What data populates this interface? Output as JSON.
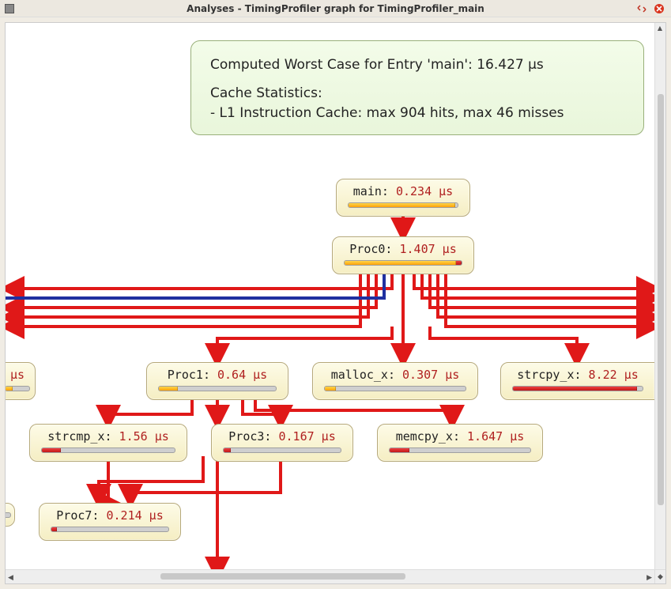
{
  "window": {
    "title": "Analyses - TimingProfiler graph for TimingProfiler_main"
  },
  "stats": {
    "line1": "Computed Worst Case for Entry 'main': 16.427 µs",
    "line2": "Cache Statistics:",
    "line3": " - L1 Instruction Cache: max 904 hits, max 46 misses"
  },
  "nodes": {
    "main": {
      "name": "main",
      "time": "0.234 µs",
      "fill_pct": 98,
      "fill_color": "orange"
    },
    "proc0": {
      "name": "Proc0",
      "time": "1.407 µs",
      "fill_pct": 95,
      "fill_color": "orange",
      "tail_color": "red"
    },
    "left_cut": {
      "name": "",
      "time": "µs",
      "fill_pct": 18,
      "fill_color": "orange"
    },
    "proc1": {
      "name": "Proc1",
      "time": "0.64 µs",
      "fill_pct": 16,
      "fill_color": "orange"
    },
    "mallocx": {
      "name": "malloc_x",
      "time": "0.307 µs",
      "fill_pct": 8,
      "fill_color": "orange"
    },
    "strcpyx": {
      "name": "strcpy_x",
      "time": "8.22 µs",
      "fill_pct": 96,
      "fill_color": "red"
    },
    "strcmpx": {
      "name": "strcmp_x",
      "time": "1.56 µs",
      "fill_pct": 14,
      "fill_color": "red"
    },
    "proc3": {
      "name": "Proc3",
      "time": "0.167 µs",
      "fill_pct": 6,
      "fill_color": "red"
    },
    "memcpyx": {
      "name": "memcpy_x",
      "time": "1.647 µs",
      "fill_pct": 14,
      "fill_color": "red"
    },
    "proc7": {
      "name": "Proc7",
      "time": "0.214 µs",
      "fill_pct": 5,
      "fill_color": "red"
    },
    "bot_cut": {
      "name": "",
      "time": "",
      "fill_pct": 0,
      "fill_color": "orange"
    }
  }
}
